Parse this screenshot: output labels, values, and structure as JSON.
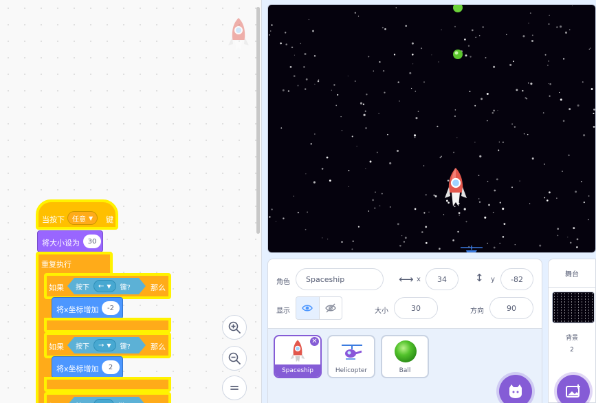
{
  "code_area": {
    "script": {
      "hat_prefix": "当按下",
      "hat_key": "任意",
      "hat_suffix": "键",
      "set_size_label": "将大小设为",
      "set_size_value": "30",
      "forever_label": "重复执行",
      "if1": {
        "if_label": "如果",
        "key_prefix": "按下",
        "key": "←",
        "key_suffix": "键?",
        "then_label": "那么",
        "action_label": "将x坐标增加",
        "action_value": "-2"
      },
      "if2": {
        "if_label": "如果",
        "key_prefix": "按下",
        "key": "→",
        "key_suffix": "键?",
        "then_label": "那么",
        "action_label": "将x坐标增加",
        "action_value": "2"
      },
      "if3": {
        "if_label": "如果",
        "key_prefix": "按下",
        "key_suffix": "键?",
        "then_label": "那么"
      }
    },
    "zoom": {
      "zoom_in_icon": "zoom-in-icon",
      "zoom_out_icon": "zoom-out-icon",
      "reset_icon": "zoom-reset-icon"
    }
  },
  "sprite_info": {
    "sprite_label": "角色",
    "sprite_name": "Spaceship",
    "x_label": "x",
    "x_value": "34",
    "y_label": "y",
    "y_value": "-82",
    "show_label": "显示",
    "size_label": "大小",
    "size_value": "30",
    "direction_label": "方向",
    "direction_value": "90"
  },
  "sprites": [
    {
      "name": "Spaceship",
      "selected": true
    },
    {
      "name": "Helicopter",
      "selected": false
    },
    {
      "name": "Ball",
      "selected": false
    }
  ],
  "stage_pane": {
    "title": "舞台",
    "backdrop_label": "背景",
    "backdrop_count": "2"
  },
  "colors": {
    "events": "#ffbf00",
    "control": "#ffab19",
    "looks": "#9966ff",
    "motion": "#4c97ff",
    "sensing": "#5cb1d6",
    "highlight": "#fff200",
    "accent": "#855cd6",
    "stage_bg": "#05020d"
  }
}
